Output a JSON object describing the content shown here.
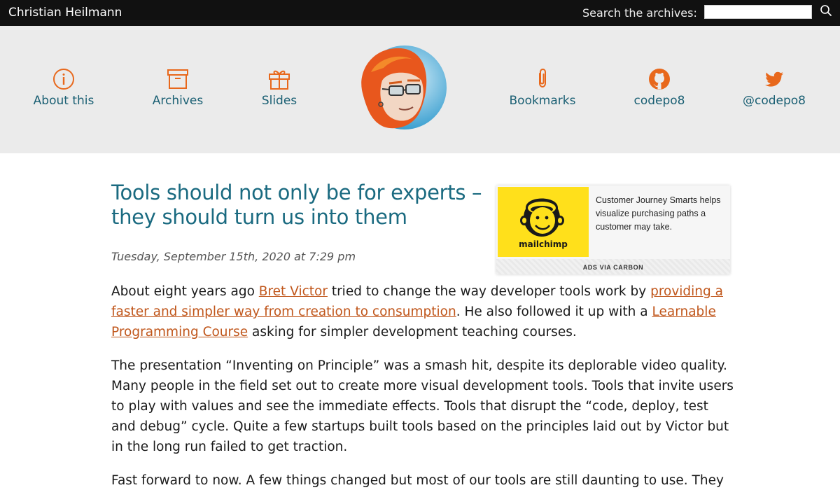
{
  "header": {
    "site_title": "Christian Heilmann",
    "search": {
      "label": "Search the archives:",
      "value": "",
      "placeholder": ""
    }
  },
  "nav": {
    "items": [
      {
        "label": "About this",
        "icon": "info-icon"
      },
      {
        "label": "Archives",
        "icon": "archive-box-icon"
      },
      {
        "label": "Slides",
        "icon": "gift-icon"
      },
      {
        "label": "Bookmarks",
        "icon": "paperclip-icon"
      },
      {
        "label": "codepo8",
        "icon": "github-icon"
      },
      {
        "label": "@codepo8",
        "icon": "twitter-icon"
      }
    ],
    "avatar": "avatar-illustration",
    "accent_color": "#e8681c",
    "link_color": "#1a5f73"
  },
  "post": {
    "title": "Tools should not only be for experts – they should turn us into them",
    "date": "Tuesday, September 15th, 2020 at 7:29 pm",
    "paragraphs": [
      {
        "t1": "About eight years ago ",
        "l1": "Bret Victor",
        "t2": " tried to change the way developer tools work by ",
        "l2": "providing a faster and simpler way from creation to consumption",
        "t3": ". He also followed it up with a ",
        "l3": "Learnable Programming Course",
        "t4": " asking for simpler development teaching courses."
      },
      {
        "text": "The presentation “Inventing on Principle” was a smash hit, despite its deplorable video quality. Many people in the field set out to create more visual development tools. Tools that invite users to play with values and see the immediate effects. Tools that disrupt the “code, deploy, test and debug” cycle. Quite a few startups built tools based on the principles laid out by Victor but in the long run failed to get traction."
      },
      {
        "text": "Fast forward to now. A few things changed but most of our tools are still daunting to use. They"
      }
    ],
    "link_color": "#c0561b",
    "title_color": "#1a6a80"
  },
  "ad": {
    "brand": "mailchimp",
    "text": "Customer Journey Smarts helps visualize purchasing paths a customer may take.",
    "footer": "ADS VIA CARBON",
    "brand_color": "#ffe01b"
  }
}
